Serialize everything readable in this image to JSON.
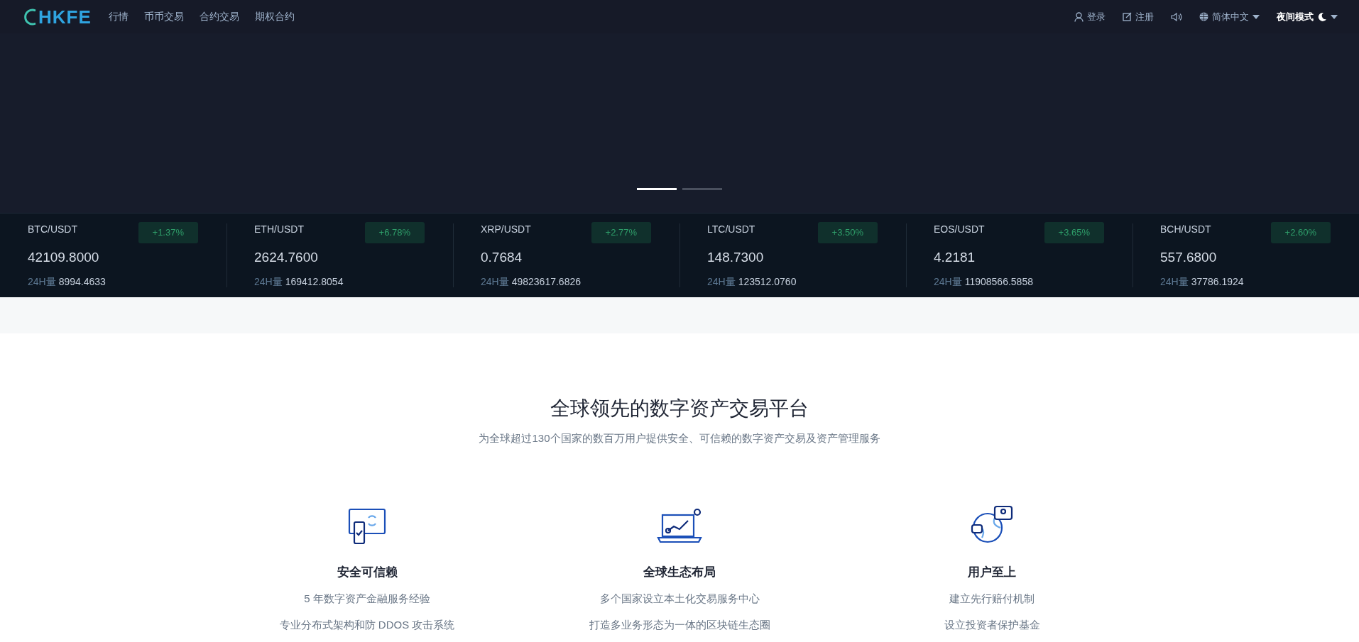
{
  "header": {
    "logo": "HKFE",
    "nav": [
      {
        "label": "行情"
      },
      {
        "label": "币币交易"
      },
      {
        "label": "合约交易"
      },
      {
        "label": "期权合约"
      }
    ],
    "actions": [
      {
        "kind": "login",
        "label": "登录"
      },
      {
        "kind": "register",
        "label": "注册"
      },
      {
        "kind": "sound"
      },
      {
        "kind": "language",
        "label": "简体中文"
      },
      {
        "kind": "theme",
        "label": "夜间模式"
      }
    ]
  },
  "carousel": {
    "slides": [
      {
        "selected": true
      },
      {
        "selected": false
      }
    ]
  },
  "tickers": [
    {
      "pair": "BTC/USDT",
      "change": "+1.37%",
      "price": "42109.8000",
      "volume_label": "24H量",
      "volume": "8994.4633"
    },
    {
      "pair": "ETH/USDT",
      "change": "+6.78%",
      "price": "2624.7600",
      "volume_label": "24H量",
      "volume": "169412.8054"
    },
    {
      "pair": "XRP/USDT",
      "change": "+2.77%",
      "price": "0.7684",
      "volume_label": "24H量",
      "volume": "49823617.6826"
    },
    {
      "pair": "LTC/USDT",
      "change": "+3.50%",
      "price": "148.7300",
      "volume_label": "24H量",
      "volume": "123512.0760"
    },
    {
      "pair": "EOS/USDT",
      "change": "+3.65%",
      "price": "4.2181",
      "volume_label": "24H量",
      "volume": "11908566.5858"
    },
    {
      "pair": "BCH/USDT",
      "change": "+2.60%",
      "price": "557.6800",
      "volume_label": "24H量",
      "volume": "37786.1924"
    }
  ],
  "intro": {
    "title": "全球领先的数字资产交易平台",
    "subtitle": "为全球超过130个国家的数百万用户提供安全、可信赖的数字资产交易及资产管理服务"
  },
  "features": [
    {
      "kind": "security",
      "title": "安全可信赖",
      "lines": [
        "5 年数字资产金融服务经验",
        "专业分布式架构和防 DDOS 攻击系统"
      ]
    },
    {
      "kind": "global",
      "title": "全球生态布局",
      "lines": [
        "多个国家设立本土化交易服务中心",
        "打造多业务形态为一体的区块链生态圈"
      ]
    },
    {
      "kind": "users",
      "title": "用户至上",
      "lines": [
        "建立先行赔付机制",
        "设立投资者保护基金"
      ]
    }
  ]
}
